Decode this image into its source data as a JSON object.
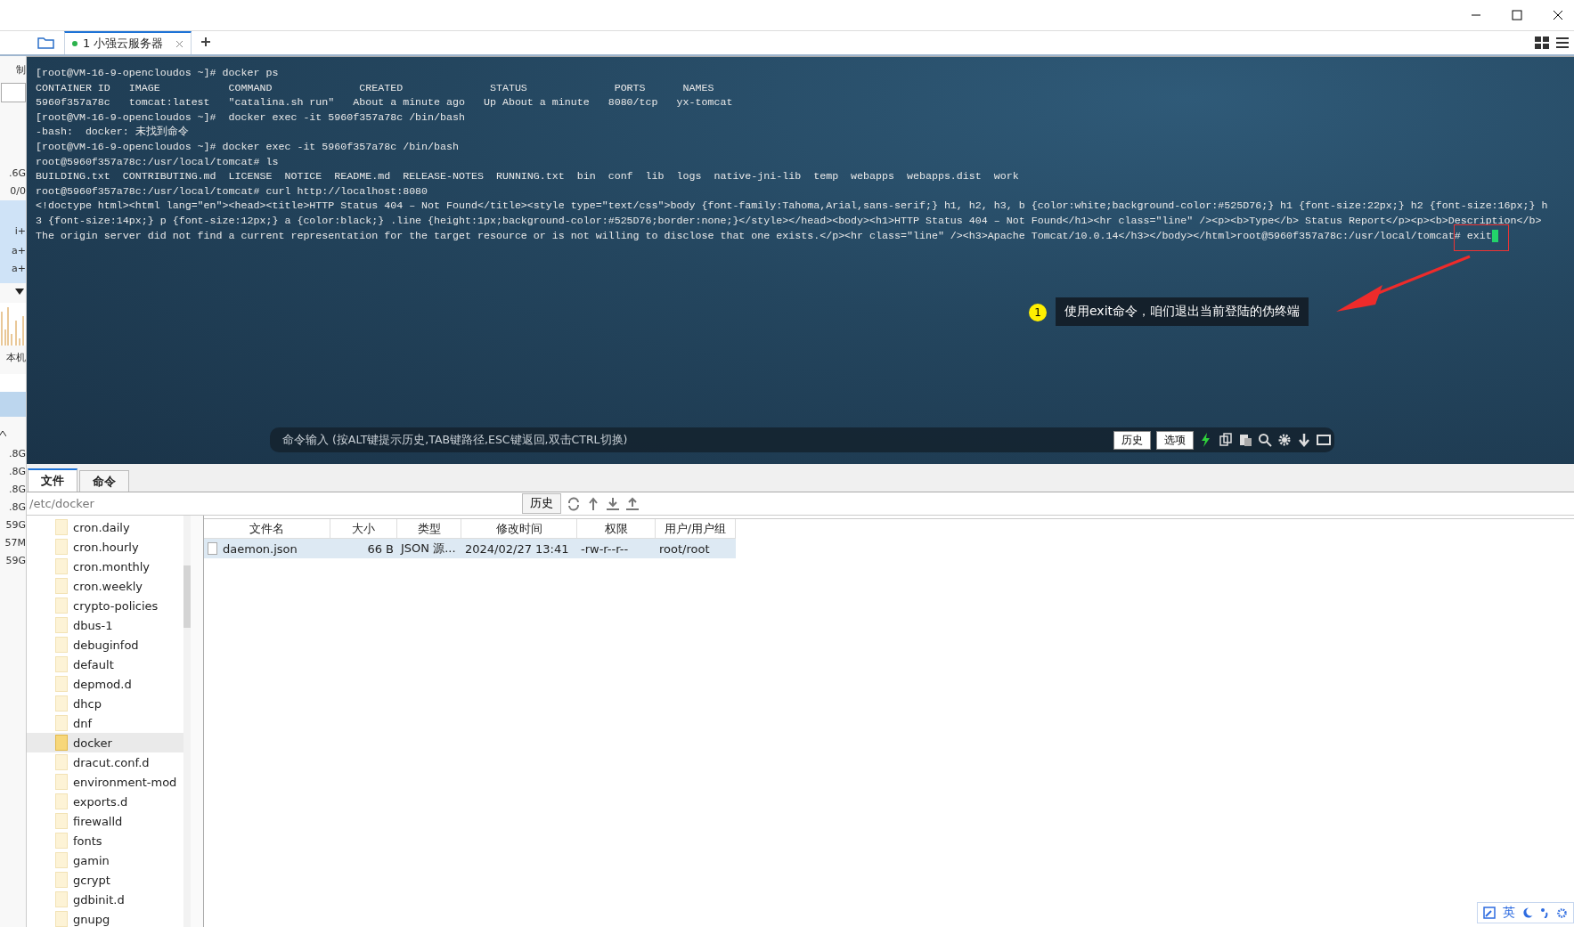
{
  "window": {
    "tabs": [
      {
        "label": "1 小强云服务器",
        "selected": true
      }
    ]
  },
  "left_strip": {
    "texts": [
      "制",
      ".6G",
      "0/0",
      "i+",
      "a+",
      "a+",
      "本机",
      ".8G",
      ".8G",
      ".8G",
      ".8G",
      "59G",
      "57M",
      "59G"
    ]
  },
  "terminal": {
    "lines": [
      "[root@VM-16-9-opencloudos ~]# docker ps",
      "CONTAINER ID   IMAGE           COMMAND              CREATED              STATUS              PORTS      NAMES",
      "5960f357a78c   tomcat:latest   \"catalina.sh run\"   About a minute ago   Up About a minute   8080/tcp   yx-tomcat",
      "[root@VM-16-9-opencloudos ~]#  docker exec -it 5960f357a78c /bin/bash",
      "-bash:  docker: 未找到命令",
      "[root@VM-16-9-opencloudos ~]# docker exec -it 5960f357a78c /bin/bash",
      "root@5960f357a78c:/usr/local/tomcat# ls",
      "BUILDING.txt  CONTRIBUTING.md  LICENSE  NOTICE  README.md  RELEASE-NOTES  RUNNING.txt  bin  conf  lib  logs  native-jni-lib  temp  webapps  webapps.dist  work",
      "root@5960f357a78c:/usr/local/tomcat# curl http://localhost:8080",
      "<!doctype html><html lang=\"en\"><head><title>HTTP Status 404 – Not Found</title><style type=\"text/css\">body {font-family:Tahoma,Arial,sans-serif;} h1, h2, h3, b {color:white;background-color:#525D76;} h1 {font-size:22px;} h2 {font-size:16px;} h",
      "3 {font-size:14px;} p {font-size:12px;} a {color:black;} .line {height:1px;background-color:#525D76;border:none;}</style></head><body><h1>HTTP Status 404 – Not Found</h1><hr class=\"line\" /><p><b>Type</b> Status Report</p><p><b>Description</b>",
      "The origin server did not find a current representation for the target resource or is not willing to disclose that one exists.</p><hr class=\"line\" /><h3>Apache Tomcat/10.0.14</h3></body></html>root@5960f357a78c:/usr/local/tomcat# exit"
    ],
    "annotation": {
      "number": "1",
      "text": "使用exit命令，咱们退出当前登陆的伪终端"
    },
    "command_bar": {
      "placeholder": "命令输入 (按ALT键提示历史,TAB键路径,ESC键返回,双击CTRL切换)",
      "buttons": [
        "历史",
        "选项"
      ]
    }
  },
  "bottom_tabs": [
    {
      "label": "文件",
      "selected": true
    },
    {
      "label": "命令",
      "selected": false
    }
  ],
  "path_bar": {
    "value": "/etc/docker",
    "button": "历史"
  },
  "tree": [
    {
      "name": "cron.daily",
      "selected": false
    },
    {
      "name": "cron.hourly",
      "selected": false
    },
    {
      "name": "cron.monthly",
      "selected": false
    },
    {
      "name": "cron.weekly",
      "selected": false
    },
    {
      "name": "crypto-policies",
      "selected": false
    },
    {
      "name": "dbus-1",
      "selected": false
    },
    {
      "name": "debuginfod",
      "selected": false
    },
    {
      "name": "default",
      "selected": false
    },
    {
      "name": "depmod.d",
      "selected": false
    },
    {
      "name": "dhcp",
      "selected": false
    },
    {
      "name": "dnf",
      "selected": false
    },
    {
      "name": "docker",
      "selected": true
    },
    {
      "name": "dracut.conf.d",
      "selected": false
    },
    {
      "name": "environment-mod",
      "selected": false
    },
    {
      "name": "exports.d",
      "selected": false
    },
    {
      "name": "firewalld",
      "selected": false
    },
    {
      "name": "fonts",
      "selected": false
    },
    {
      "name": "gamin",
      "selected": false
    },
    {
      "name": "gcrypt",
      "selected": false
    },
    {
      "name": "gdbinit.d",
      "selected": false
    },
    {
      "name": "gnupg",
      "selected": false
    }
  ],
  "table": {
    "columns": [
      "文件名",
      "大小",
      "类型",
      "修改时间",
      "权限",
      "用户/用户组"
    ],
    "rows": [
      {
        "cells": [
          "daemon.json",
          "66 B",
          "JSON 源...",
          "2024/02/27 13:41",
          "-rw-r--r--",
          "root/root"
        ],
        "selected": true
      }
    ]
  },
  "ime_bar": {
    "label": "英"
  }
}
